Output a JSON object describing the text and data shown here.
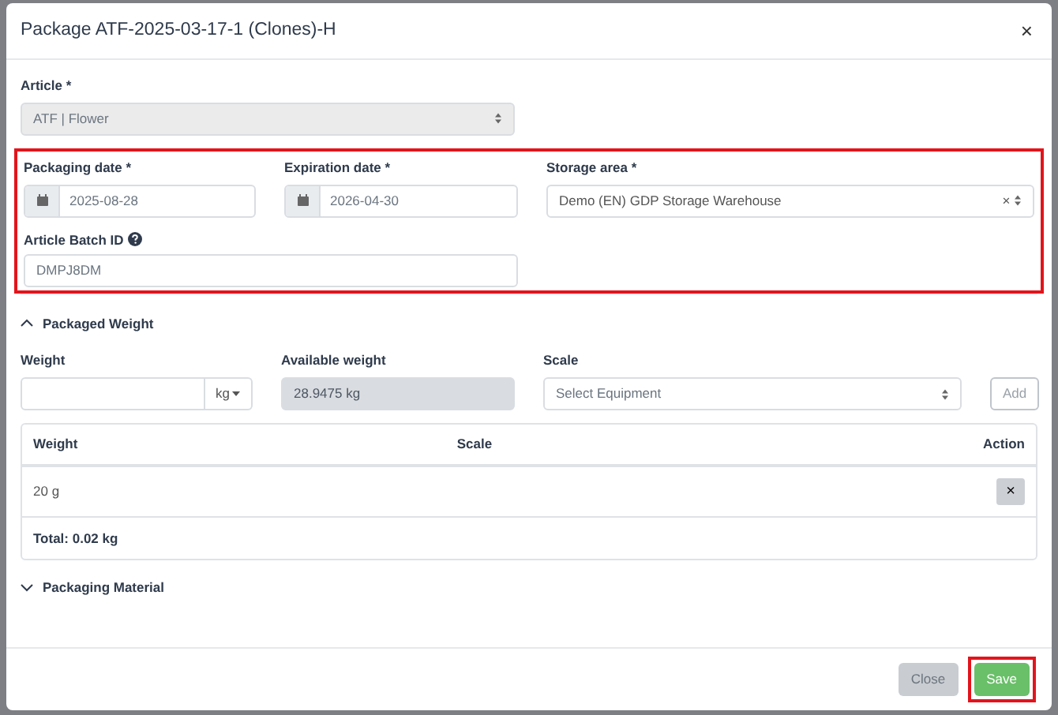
{
  "dialog": {
    "title": "Package ATF-2025-03-17-1 (Clones)-H",
    "close_icon": "×"
  },
  "article": {
    "label": "Article",
    "required_mark": "*",
    "value": "ATF | Flower",
    "disabled": true
  },
  "details": {
    "highlighted": true,
    "fields": [
      {
        "kind": "date",
        "label": "Packaging date",
        "required_mark": "*",
        "value": "2025-08-28"
      },
      {
        "kind": "date",
        "label": "Expiration date",
        "required_mark": "*",
        "value": "2026-04-30"
      },
      {
        "kind": "select",
        "label": "Storage area",
        "required_mark": "*",
        "value": "Demo (EN) GDP Storage Warehouse",
        "clear_icon": "×"
      }
    ],
    "batch": {
      "label": "Article Batch ID",
      "value": "DMPJ8DM"
    }
  },
  "packaged_weight": {
    "title": "Packaged Weight",
    "expanded": true,
    "weight": {
      "label": "Weight",
      "unit": "kg"
    },
    "available": {
      "label": "Available weight",
      "value": "28.9475 kg"
    },
    "scale": {
      "label": "Scale",
      "placeholder": "Select Equipment"
    },
    "add_button": {
      "label": "Add",
      "disabled": true
    },
    "table": {
      "columns": [
        "Weight",
        "Scale",
        "Action"
      ],
      "rows": [
        {
          "weight": "20 g",
          "remove_icon": "×"
        }
      ],
      "total": "Total: 0.02 kg"
    }
  },
  "packaging_material": {
    "title": "Packaging Material",
    "expanded": false
  },
  "footer": {
    "buttons": [
      {
        "kind": "secondary",
        "label": "Close",
        "highlighted": false
      },
      {
        "kind": "success",
        "label": "Save",
        "highlighted": true
      }
    ]
  }
}
